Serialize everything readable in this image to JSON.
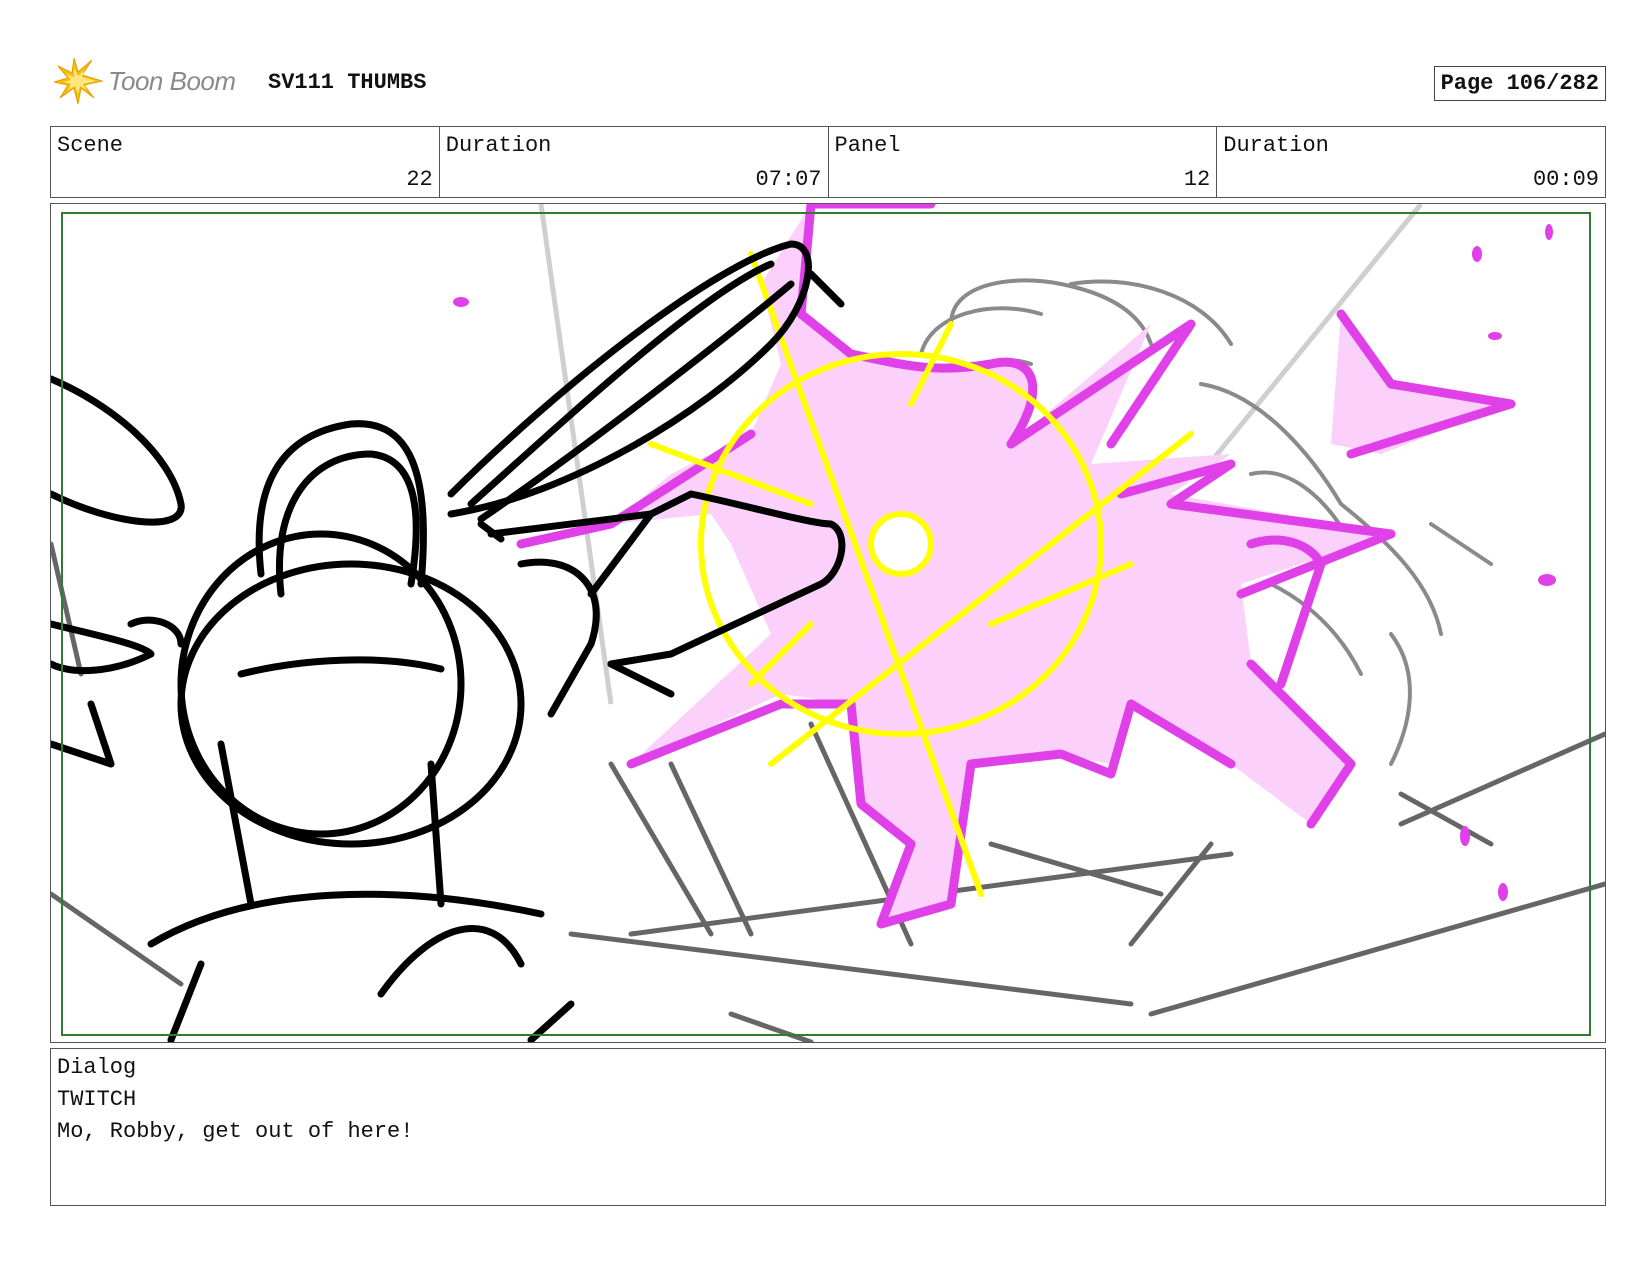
{
  "header": {
    "logo_text": "Toon Boom",
    "title": "SV111 THUMBS",
    "page": "Page 106/282"
  },
  "info": {
    "scene_label": "Scene",
    "scene_value": "22",
    "scene_duration_label": "Duration",
    "scene_duration_value": "07:07",
    "panel_label": "Panel",
    "panel_value": "12",
    "panel_duration_label": "Duration",
    "panel_duration_value": "00:09"
  },
  "colors": {
    "safe_frame": "#2e7d32",
    "energy_fill": "#fbd0fb",
    "energy_stroke": "#e040e8",
    "flash": "#ffff00"
  },
  "dialog": {
    "label": "Dialog",
    "speaker": "TWITCH",
    "line": "Mo, Robby, get out of here!"
  }
}
